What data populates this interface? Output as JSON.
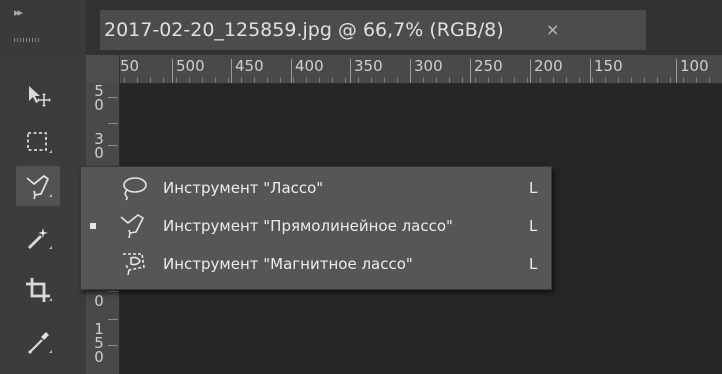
{
  "toolbar": {
    "collapse_glyph": "▸▸",
    "tools": [
      {
        "icon": "move-tool-icon"
      },
      {
        "icon": "marquee-tool-icon"
      },
      {
        "icon": "lasso-tool-icon",
        "active": true
      },
      {
        "icon": "magic-wand-tool-icon"
      },
      {
        "icon": "crop-tool-icon"
      },
      {
        "icon": "eyedropper-tool-icon"
      }
    ]
  },
  "document": {
    "tab_title": "2017-02-20_125859.jpg @ 66,7% (RGB/8)",
    "close_glyph": "×"
  },
  "rulers": {
    "horizontal_labels": [
      "50",
      "500",
      "450",
      "400",
      "350",
      "300",
      "250",
      "200",
      "150",
      "100"
    ],
    "vertical_groups": [
      [
        "5",
        "0"
      ],
      [
        "3",
        "0"
      ],
      [
        "0"
      ],
      [
        "1",
        "5",
        "0"
      ]
    ]
  },
  "flyout": {
    "items": [
      {
        "label": "Инструмент \"Лассо\"",
        "key": "L",
        "icon": "lasso-icon",
        "selected": false
      },
      {
        "label": "Инструмент \"Прямолинейное лассо\"",
        "key": "L",
        "icon": "polygonal-lasso-icon",
        "selected": true
      },
      {
        "label": "Инструмент \"Магнитное лассо\"",
        "key": "L",
        "icon": "magnetic-lasso-icon",
        "selected": false
      }
    ]
  },
  "colors": {
    "panel": "#3c3c3c",
    "canvas": "#262626",
    "flyout": "#565656",
    "text": "#ececec"
  }
}
